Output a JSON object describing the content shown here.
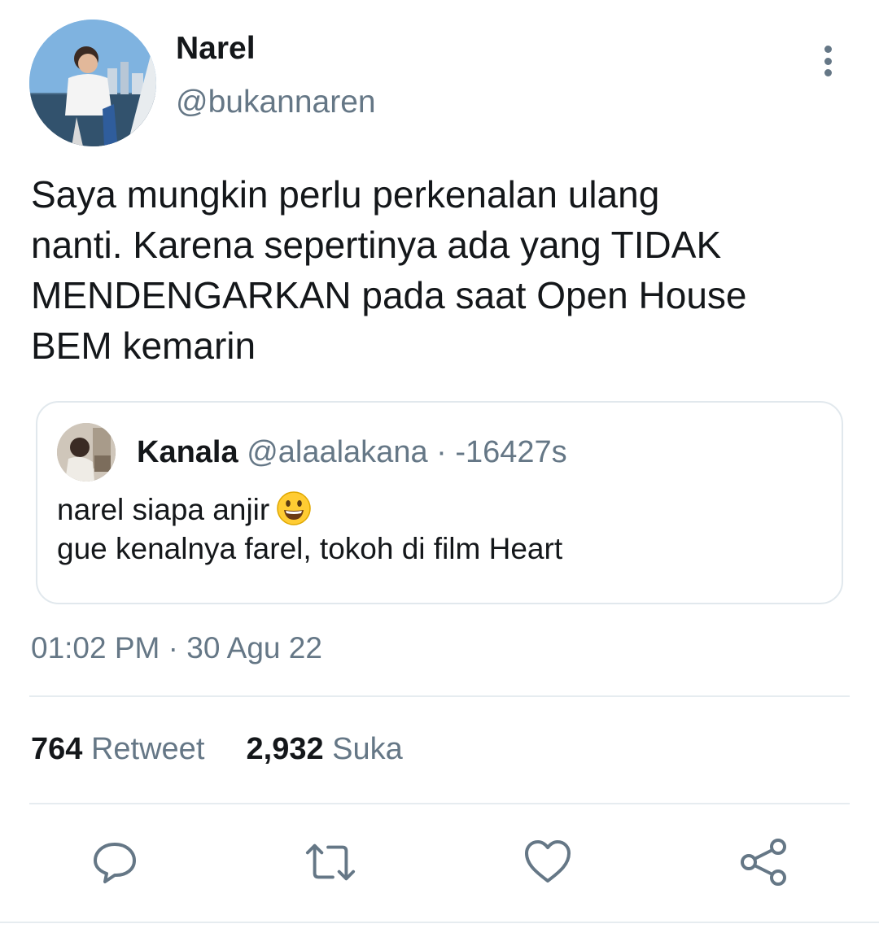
{
  "tweet": {
    "author": {
      "name": "Narel",
      "handle": "@bukannaren"
    },
    "text_lines": [
      "Saya mungkin perlu perkenalan ulang",
      "nanti. Karena sepertinya ada yang TIDAK",
      "MENDENGARKAN pada saat Open House",
      "BEM kemarin"
    ],
    "timestamp": "01:02 PM · 30 Agu 22"
  },
  "quote": {
    "name": "Kanala",
    "handle": "@alaalakana",
    "meta": "@alaalakana · -16427s",
    "line1": "narel siapa anjir",
    "line1_emoji": "grinning-face-emoji",
    "line2": "gue kenalnya farel, tokoh di film Heart"
  },
  "stats": {
    "retweets_count": "764",
    "retweets_label": "Retweet",
    "likes_count": "2,932",
    "likes_label": "Suka"
  },
  "actions": {
    "icons": [
      "reply-icon",
      "retweet-icon",
      "like-icon",
      "share-icon"
    ],
    "icon_color": "#657786"
  },
  "colors": {
    "text": "#14171a",
    "secondary": "#657786",
    "border": "#e1e8ed"
  }
}
